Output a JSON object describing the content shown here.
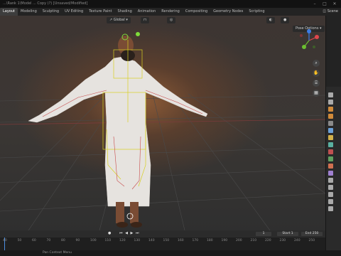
{
  "window": {
    "title": "...\\Rank 1\\Model ... Copy (?) [Unsaved/Modified]"
  },
  "menubar": {
    "tabs": [
      "Layout",
      "Modeling",
      "Sculpting",
      "UV Editing",
      "Texture Paint",
      "Shading",
      "Animation",
      "Rendering",
      "Compositing",
      "Geometry Nodes",
      "Scripting"
    ],
    "active_tab": "Layout",
    "scene_label": "Scene"
  },
  "viewport": {
    "transform_orientation": "Global",
    "pose_options": "Pose Options",
    "gizmo_axes": [
      "X",
      "Y",
      "Z"
    ]
  },
  "timeline": {
    "ticks": [
      "40",
      "50",
      "60",
      "70",
      "80",
      "90",
      "100",
      "110",
      "120",
      "130",
      "140",
      "150",
      "160",
      "170",
      "180",
      "190",
      "200",
      "210",
      "220",
      "230",
      "240",
      "250"
    ],
    "current_frame": "1",
    "start_label": "Start",
    "start_value": "1",
    "end_label": "End",
    "end_value": "250"
  },
  "statusbar": {
    "hint": "Pan Context Menu"
  },
  "colors": {
    "accent": "#4b8de0",
    "armature": "#d8d020",
    "active_tab": "#3d3d3d"
  }
}
